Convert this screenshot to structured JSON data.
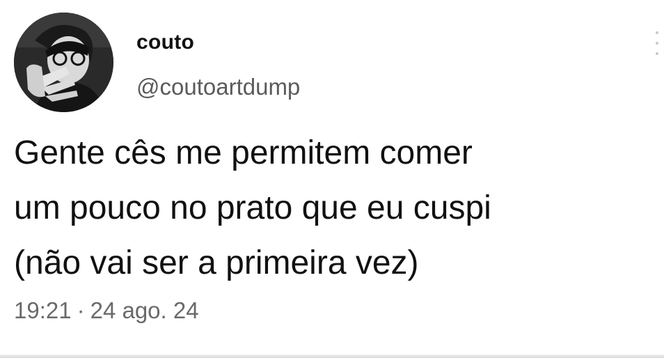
{
  "tweet": {
    "display_name": "couto",
    "handle": "@coutoartdump",
    "text_lines": [
      "Gente cês me permitem comer",
      "um pouco no prato que eu cuspi",
      "(não vai ser a primeira vez)"
    ],
    "time": "19:21",
    "separator": "·",
    "date": "24 ago. 24"
  },
  "icons": {
    "avatar": "profile-photo",
    "more": "more-options-icon"
  }
}
